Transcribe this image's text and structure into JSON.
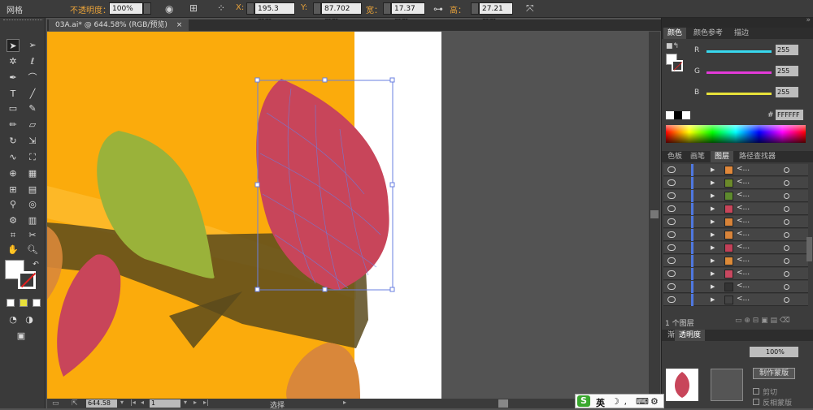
{
  "control_bar": {
    "mode_label": "网格",
    "opacity_label": "不透明度：",
    "opacity_value": "100%",
    "x_label": "X:",
    "x_value": "195.3 mm",
    "y_label": "Y:",
    "y_value": "87.702 mm",
    "w_label": "宽：",
    "w_value": "17.37 mm",
    "h_label": "高：",
    "h_value": "27.21 mm"
  },
  "document": {
    "tab_label": "03A.ai* @ 644.58% (RGB/预览)",
    "close_icon": "×"
  },
  "status_bar": {
    "zoom": "644.58",
    "page": "1",
    "tool_name": "选择"
  },
  "color_panel": {
    "tabs": [
      "颜色",
      "颜色参考",
      "描边"
    ],
    "channels": [
      {
        "label": "R",
        "value": "255",
        "color": "#38d8ee"
      },
      {
        "label": "G",
        "value": "255",
        "color": "#e33ad8"
      },
      {
        "label": "B",
        "value": "255",
        "color": "#e8e23a"
      }
    ],
    "hex_label": "#",
    "hex_value": "FFFFFF"
  },
  "layers_panel": {
    "tabs": [
      "色板",
      "画笔",
      "图层",
      "路径查找器"
    ],
    "rows": [
      {
        "name": "<...",
        "thumb": "#e0883a"
      },
      {
        "name": "<...",
        "thumb": "#6c8a2a"
      },
      {
        "name": "<...",
        "thumb": "#5e8a2e"
      },
      {
        "name": "<...",
        "thumb": "#c8455a"
      },
      {
        "name": "<...",
        "thumb": "#d88338"
      },
      {
        "name": "<...",
        "thumb": "#d8843a"
      },
      {
        "name": "<...",
        "thumb": "#c24058"
      },
      {
        "name": "<...",
        "thumb": "#dc8a38"
      },
      {
        "name": "<...",
        "thumb": "#c84860"
      },
      {
        "name": "<...",
        "thumb": "#333333"
      },
      {
        "name": "<...",
        "thumb": "#444444"
      }
    ],
    "footer_label": "1 个图层"
  },
  "transparency_panel": {
    "tabs": [
      "渐",
      "透明度"
    ],
    "opacity_value": "100%",
    "make_mask_label": "制作蒙版",
    "clip_label": "剪切",
    "invert_label": "反相蒙版"
  },
  "taskbar": {
    "ime_label": "英"
  },
  "colors": {
    "artboard_orange": "#fbab0c",
    "branch": "#5a4a1c",
    "leaf_red": "#c8455a",
    "leaf_green": "#9ab23a",
    "leaf_orange": "#d9873a",
    "selection": "#6a7fe0"
  }
}
